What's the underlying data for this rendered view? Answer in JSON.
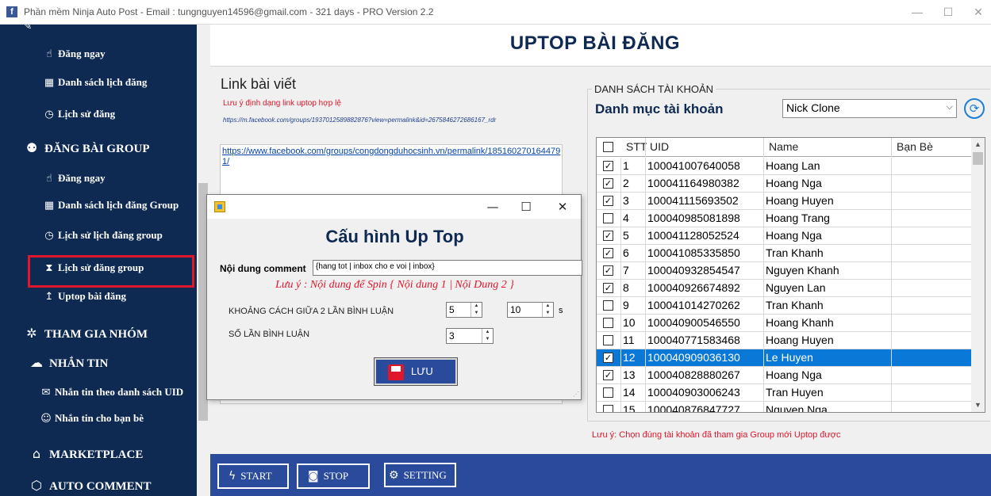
{
  "window": {
    "title": "Phần mềm Ninja Auto Post - Email : tungnguyen14596@gmail.com - 321 days -  PRO Version 2.2",
    "app_icon": "f"
  },
  "sidebar": {
    "items": [
      {
        "label": "Đăng ngay",
        "icon": "hand-pointer-icon"
      },
      {
        "label": "Danh sách lịch đăng",
        "icon": "calendar-icon"
      },
      {
        "label": "Lịch sử đăng",
        "icon": "clock-icon"
      },
      {
        "label": "ĐĂNG BÀI GROUP",
        "icon": "users-icon"
      },
      {
        "label": "Đăng ngay",
        "icon": "hand-pointer-icon"
      },
      {
        "label": "Danh sách lịch đăng Group",
        "icon": "calendar-icon"
      },
      {
        "label": "Lịch sử lịch đăng group",
        "icon": "clock-icon"
      },
      {
        "label": "Lịch sử đăng group",
        "icon": "hourglass-icon"
      },
      {
        "label": "Uptop bài đăng",
        "icon": "arrow-up-icon"
      },
      {
        "label": "THAM GIA NHÓM",
        "icon": "group-icon"
      },
      {
        "label": "NHẮN TIN",
        "icon": "chat-icon"
      },
      {
        "label": "Nhắn tin theo danh sách UID",
        "icon": "envelope-icon"
      },
      {
        "label": "Nhắn tin cho bạn bè",
        "icon": "user-chat-icon"
      },
      {
        "label": "MARKETPLACE",
        "icon": "store-icon"
      },
      {
        "label": "AUTO COMMENT",
        "icon": "box-icon"
      }
    ]
  },
  "main": {
    "header": "UPTOP BÀI ĐĂNG",
    "link_label": "Link bài viết",
    "link_note": "Lưu ý định dạng link uptop hợp lệ",
    "link_example": "https://m.facebook.com/groups/1937012589882876?view=permalink&id=2675846272686167_rdr",
    "link_value": "https://www.facebook.com/groups/congdongduhocsinh.vn/permalink/1851602701644791/",
    "accounts": {
      "group_title": "DANH SÁCH TÀI KHOẢN",
      "category_label": "Danh mục tài khoản",
      "category_value": "Nick Clone",
      "columns": [
        "STT",
        "UID",
        "Name",
        "Bạn Bè"
      ],
      "rows": [
        {
          "checked": true,
          "stt": "1",
          "uid": "100041007640058",
          "name": "Hoang Lan",
          "friends": ""
        },
        {
          "checked": true,
          "stt": "2",
          "uid": "100041164980382",
          "name": "Hoang Nga",
          "friends": ""
        },
        {
          "checked": true,
          "stt": "3",
          "uid": "100041115693502",
          "name": "Hoang Huyen",
          "friends": ""
        },
        {
          "checked": false,
          "stt": "4",
          "uid": "100040985081898",
          "name": "Hoang Trang",
          "friends": ""
        },
        {
          "checked": true,
          "stt": "5",
          "uid": "100041128052524",
          "name": "Hoang Nga",
          "friends": ""
        },
        {
          "checked": true,
          "stt": "6",
          "uid": "100041085335850",
          "name": "Tran Khanh",
          "friends": ""
        },
        {
          "checked": true,
          "stt": "7",
          "uid": "100040932854547",
          "name": "Nguyen Khanh",
          "friends": ""
        },
        {
          "checked": true,
          "stt": "8",
          "uid": "100040926674892",
          "name": "Nguyen Lan",
          "friends": ""
        },
        {
          "checked": false,
          "stt": "9",
          "uid": "100041014270262",
          "name": "Tran Khanh",
          "friends": ""
        },
        {
          "checked": false,
          "stt": "10",
          "uid": "100040900546550",
          "name": "Hoang Khanh",
          "friends": ""
        },
        {
          "checked": false,
          "stt": "11",
          "uid": "100040771583468",
          "name": "Hoang Huyen",
          "friends": ""
        },
        {
          "checked": true,
          "stt": "12",
          "uid": "100040909036130",
          "name": "Le Huyen",
          "friends": "",
          "selected": true
        },
        {
          "checked": true,
          "stt": "13",
          "uid": "100040828880267",
          "name": "Hoang Nga",
          "friends": ""
        },
        {
          "checked": false,
          "stt": "14",
          "uid": "100040903006243",
          "name": "Tran Huyen",
          "friends": ""
        },
        {
          "checked": false,
          "stt": "15",
          "uid": "100040876847727",
          "name": "Nguyen Nga",
          "friends": ""
        }
      ]
    },
    "account_note": "Lưu ý: Chọn đúng tài khoản đã tham gia Group mới Uptop được"
  },
  "bottom": {
    "start": "START",
    "stop": "STOP",
    "setting": "SETTING"
  },
  "dialog": {
    "title": "Cấu hình Up Top",
    "comment_label": "Nội dung comment",
    "comment_value": "{hang tot | inbox cho e voi | inbox}",
    "spin_note": "Lưu ý : Nội dung để Spin { Nội dung 1 | Nội Dung 2 }",
    "interval_label": "KHOẢNG CÁCH GIỮA 2 LẦN BÌNH LUẬN",
    "interval_from": "5",
    "interval_to": "10",
    "interval_unit": "s",
    "count_label": "SỐ LẦN BÌNH LUẬN",
    "count_value": "3",
    "save_label": "LƯU"
  },
  "colors": {
    "sidebar_bg": "#0e2a52",
    "accent_red": "#e0162b",
    "bottom_bar": "#2a4a9b",
    "selected_row": "#0a78d7"
  }
}
